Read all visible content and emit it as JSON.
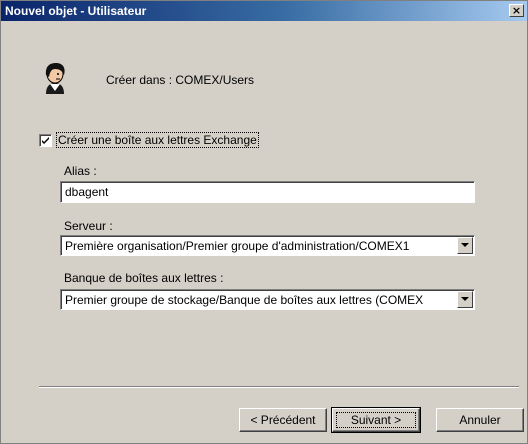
{
  "window": {
    "title": "Nouvel objet - Utilisateur",
    "close_glyph": "×"
  },
  "header": {
    "icon": "user-icon",
    "create_in_text": "Créer dans : COMEX/Users"
  },
  "mailbox": {
    "checked": true,
    "label": "Créer une boîte aux lettres Exchange"
  },
  "alias": {
    "label": "Alias :",
    "value": "dbagent"
  },
  "server": {
    "label": "Serveur :",
    "selected": "Première organisation/Premier groupe d'administration/COMEX1"
  },
  "store": {
    "label": "Banque de boîtes aux lettres :",
    "selected": "Premier groupe de stockage/Banque de boîtes aux lettres (COMEX"
  },
  "buttons": {
    "back": "< Précédent",
    "next": "Suivant >",
    "cancel": "Annuler"
  },
  "colors": {
    "dialog_bg": "#d4d0c8",
    "titlebar_start": "#0a246a",
    "titlebar_end": "#a6caf0"
  }
}
